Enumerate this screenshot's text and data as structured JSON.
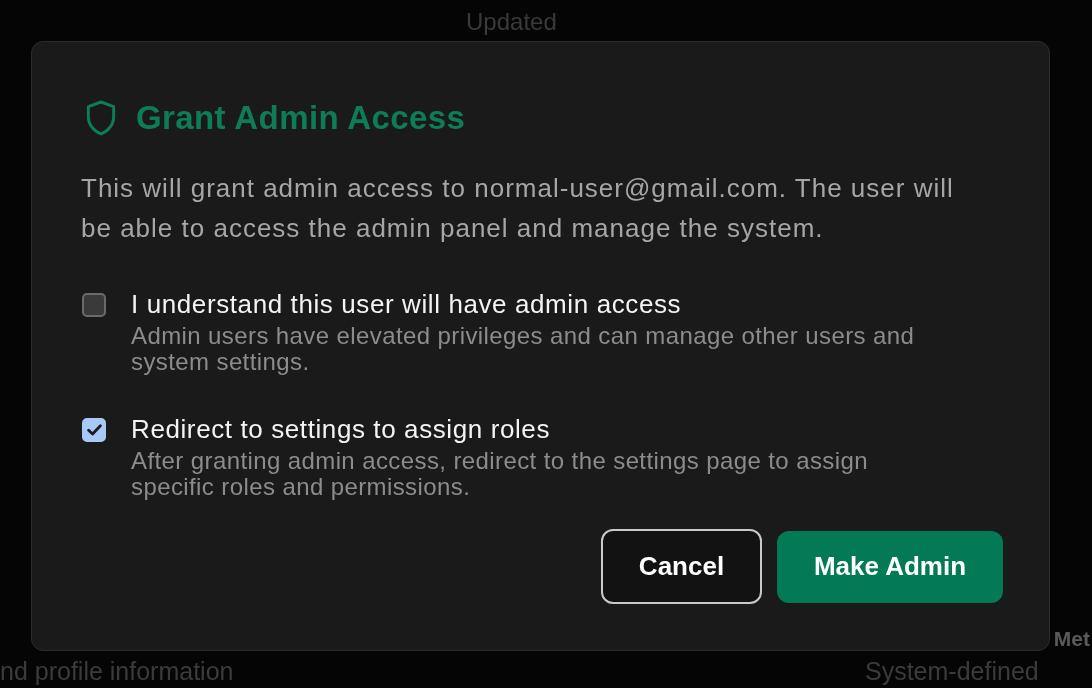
{
  "background": {
    "top_heading": "Updated",
    "bottom_left_text": "nd profile information",
    "bottom_right_heading": "Met",
    "bottom_right_text": "System-defined"
  },
  "dialog": {
    "title": "Grant Admin Access",
    "description": "This will grant admin access to normal-user@gmail.com. The user will be able to access the admin panel and manage the system.",
    "options": [
      {
        "label": "I understand this user will have admin access",
        "description": "Admin users have elevated privileges and can manage other users and system settings.",
        "checked": false
      },
      {
        "label": "Redirect to settings to assign roles",
        "description": "After granting admin access, redirect to the settings page to assign specific roles and permissions.",
        "checked": true
      }
    ],
    "buttons": [
      {
        "label": "Cancel",
        "kind": "secondary"
      },
      {
        "label": "Make Admin",
        "kind": "primary"
      }
    ]
  }
}
